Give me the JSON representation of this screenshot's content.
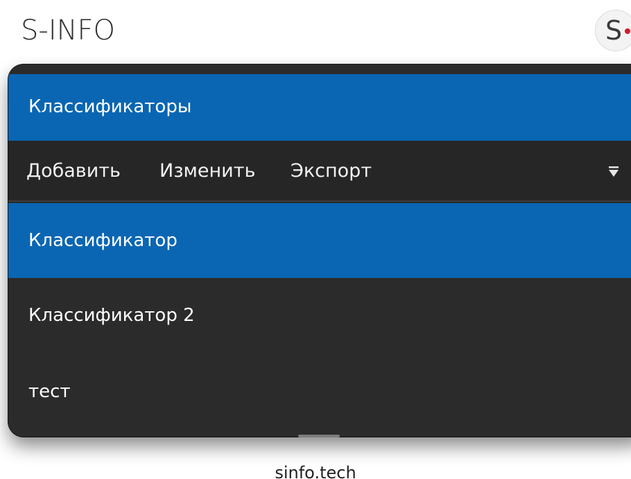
{
  "app": {
    "title": "S-INFO",
    "logo_letter": "S"
  },
  "dialog": {
    "title": "Классификаторы",
    "toolbar": {
      "add_label": "Добавить",
      "edit_label": "Изменить",
      "export_label": "Экспорт",
      "more_icon": "triangle-down-icon"
    },
    "items": [
      {
        "label": "Классификатор",
        "selected": true
      },
      {
        "label": "Классификатор 2",
        "selected": false
      },
      {
        "label": "тест",
        "selected": false
      }
    ]
  },
  "footer": {
    "text": "sinfo.tech"
  },
  "colors": {
    "accent": "#0a66b3",
    "panel_bg": "#2b2b2b",
    "toolbar_bg": "#262626",
    "logo_dot": "#d01c2a"
  }
}
